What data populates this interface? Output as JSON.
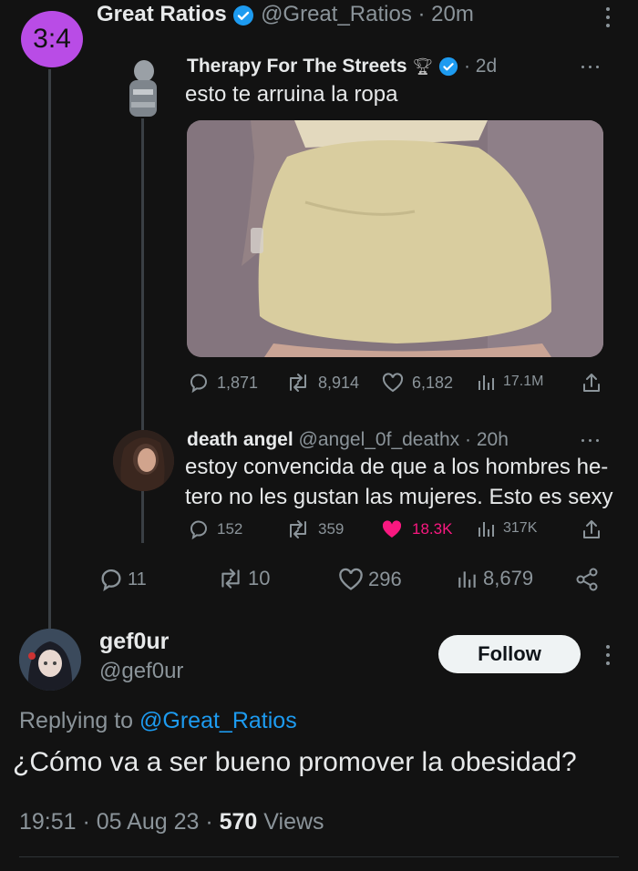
{
  "main_tweet": {
    "avatar_text": "3:4",
    "author_name": "Great Ratios",
    "handle_time": "@Great_Ratios · 20m",
    "stats": {
      "replies": "11",
      "retweets": "10",
      "likes": "296",
      "views": "8,679"
    }
  },
  "quoted_tweet": {
    "author_name": "Therapy For The Streets",
    "time": "· 2d",
    "text": "esto te arruina la ropa",
    "stats": {
      "replies": "1,871",
      "retweets": "8,914",
      "likes": "6,182",
      "views": "17.1M"
    }
  },
  "reply_tweet": {
    "author_name": "death angel",
    "handle_time": "@angel_0f_deathx · 20h",
    "text_line1": "estoy convencida de que a los hombres he-",
    "text_line2": "tero no les gustan las mujeres. Esto es sexy",
    "stats": {
      "replies": "152",
      "retweets": "359",
      "likes": "18.3K",
      "views": "317K"
    }
  },
  "focus_tweet": {
    "author_name": "gef0ur",
    "handle": "@gef0ur",
    "follow_label": "Follow",
    "replying_prefix": "Replying to",
    "replying_handle": "@Great_Ratios",
    "text": "¿Cómo va a ser bueno promover la obesidad?",
    "time": "19:51 · 05 Aug 23 ·",
    "views_count": "570",
    "views_label": "Views"
  },
  "colors": {
    "like_active": "#f91880",
    "verified": "#1d9bf0",
    "handle_link": "#1d9bf0",
    "background": "#121212"
  }
}
